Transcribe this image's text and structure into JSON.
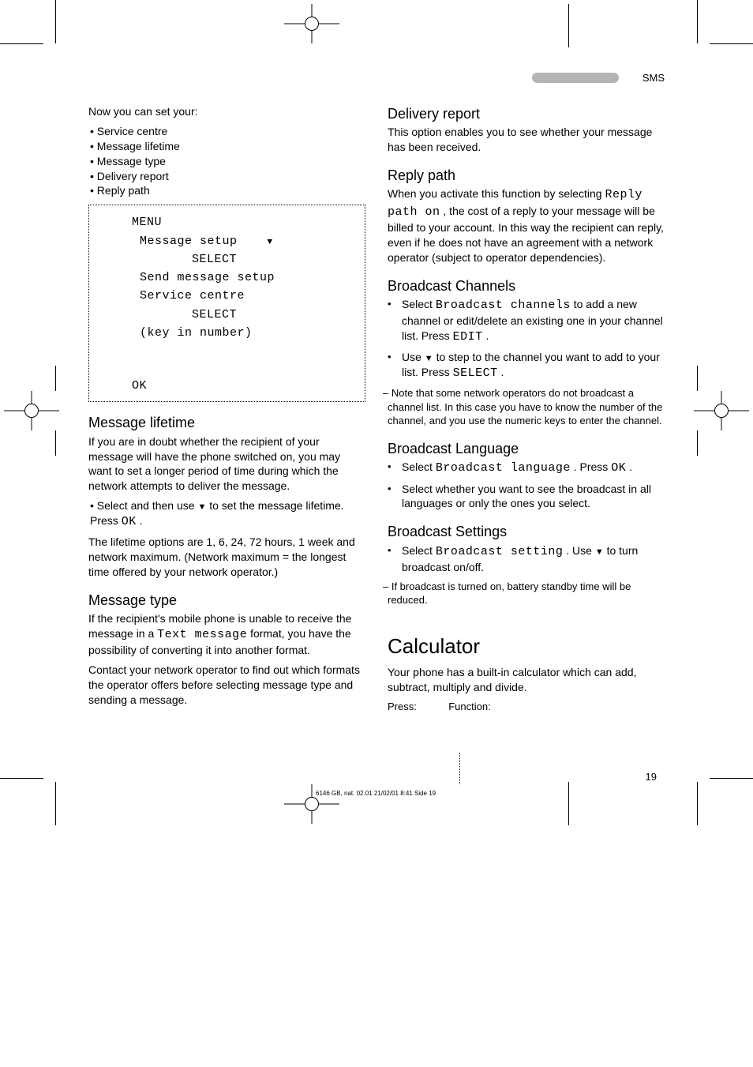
{
  "header": {
    "section": "SMS"
  },
  "left_column": {
    "intro_line": "Now you can set your:",
    "bullets": [
      "Service centre",
      "Message lifetime",
      "Message type",
      "Delivery report",
      "Reply path"
    ],
    "lcd": {
      "menu": "MENU",
      "l1a": "Message setup",
      "l1b": "SELECT",
      "l2": "Send message setup",
      "l3a": "Service centre",
      "l3b": "SELECT",
      "l4": "(key in number)",
      "l5": "OK"
    },
    "subhead1": "Message lifetime",
    "para1": "If you are in doubt whether the recipient of your message will have the phone switched on, you may want to set a longer period of time during which the network attempts to deliver the message.",
    "step_prefix": "• Select",
    "step_suffix": " and then use ",
    "step_tail": " to set the message lifetime. Press ",
    "step_end": ".",
    "lifetime_note": "The lifetime options are 1, 6, 24, 72 hours, 1 week and network maximum. (Network maximum = the longest time offered by your network operator.)",
    "subhead2": "Message type",
    "para2a": "If the recipient's mobile phone is unable to receive the message in a ",
    "text_message": "Text message",
    "para2b": " format, you have the possibility of converting it into another format.",
    "para2c": "Contact your network operator to find out which formats the operator offers before selecting message type and sending a message."
  },
  "right_column": {
    "subhead1": "Delivery report",
    "para1": "This option enables you to see whether your message has been received.",
    "subhead2": "Reply path",
    "para2a": "When you activate this function by selecting ",
    "reply_path_on": "Reply path on",
    "para2b": ", the cost of a reply to your message will be billed to your account. In this way the recipient can reply, even if he does not have an agreement with a network operator (subject to operator dependencies).",
    "subhead3": "Broadcast Channels",
    "step1_a": "Select ",
    "broadcast_channels": "Broadcast channels",
    "step1_b": " to add a new channel or edit/delete an existing one in your channel list. Press ",
    "edit": "EDIT",
    "step1_c": ".",
    "step2_a": "Use ",
    "step2_b": " to step to the channel you want to add to your list. Press ",
    "select": "SELECT",
    "step2_c": ".",
    "note1": "– Note that some network operators do not broadcast a channel list. In this case you have to know the number of the channel, and you use the numeric keys to enter the channel.",
    "subhead4": "Broadcast Language",
    "step3_a": "Select ",
    "broadcast_language": "Broadcast language",
    "step3_b": ". Press ",
    "ok": "OK",
    "step3_c": ".",
    "step4": "Select whether you want to see the broadcast in all languages or only the ones you select.",
    "subhead5": "Broadcast Settings",
    "step5_a": "Select ",
    "broadcast_setting": "Broadcast setting",
    "step5_b": ". Use ",
    "step5_c": " to turn broadcast on/off.",
    "note2": "– If broadcast is turned on, battery standby time will be reduced."
  },
  "section_title": "Calculator",
  "section_para1": "Your phone has a built-in calculator which can add, subtract, multiply and divide.",
  "section_heads": [
    {
      "label": "Press:",
      "w": "18%"
    },
    {
      "label": "Function:",
      "w": "82%"
    }
  ],
  "footer": {
    "pagenum": "19",
    "line": "6146 GB, nat. 02.01  21/02/01  8:41  Side 19"
  }
}
